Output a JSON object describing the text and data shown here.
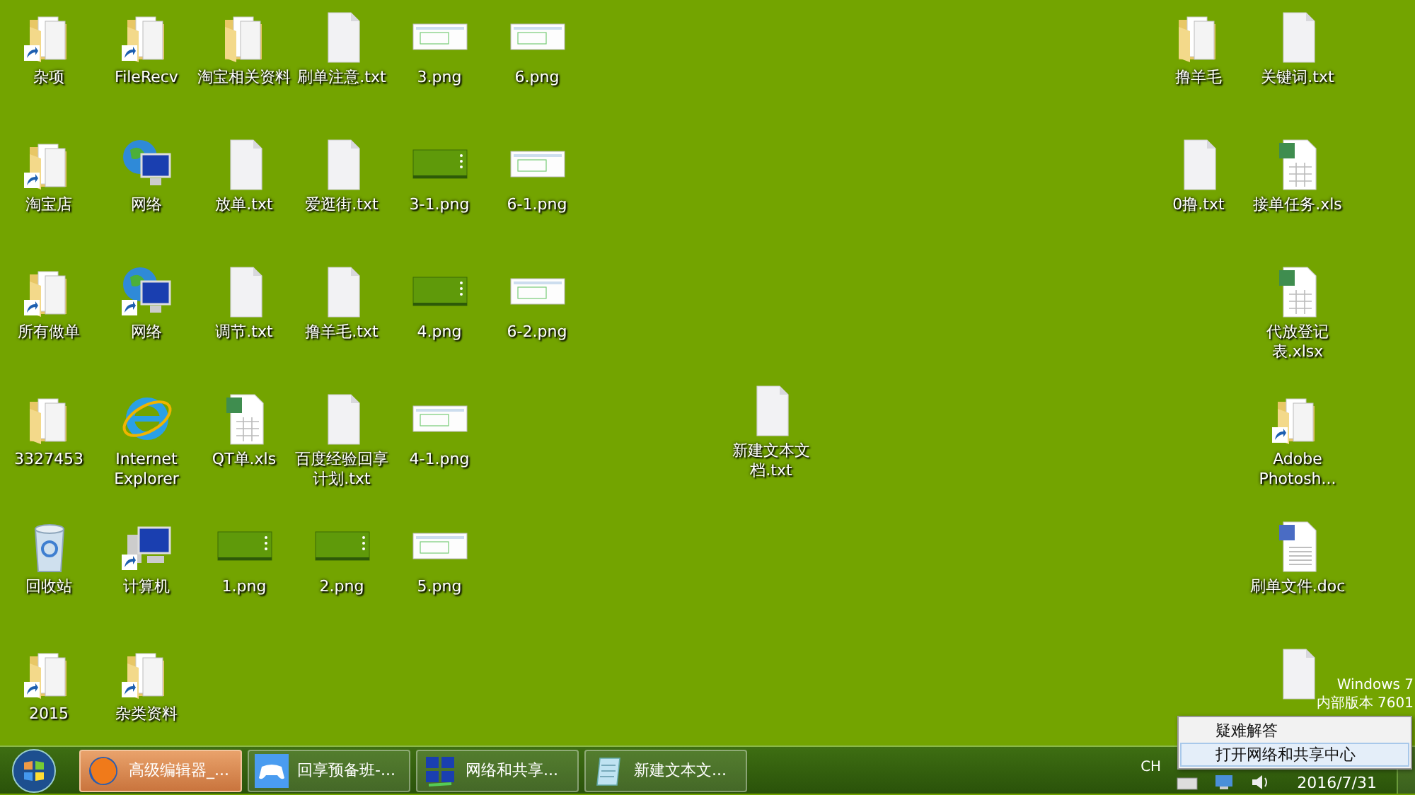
{
  "desktop": {
    "left_columns": [
      [
        {
          "label": "杂项",
          "kind": "folder",
          "shortcut": true
        },
        {
          "label": "淘宝店",
          "kind": "folder",
          "shortcut": true
        },
        {
          "label": "所有做单",
          "kind": "folder",
          "shortcut": true
        },
        {
          "label": "3327453",
          "kind": "folder",
          "shortcut": false
        },
        {
          "label": "回收站",
          "kind": "recycle",
          "shortcut": false
        },
        {
          "label": "2015",
          "kind": "folder",
          "shortcut": true
        }
      ],
      [
        {
          "label": "FileRecv",
          "kind": "folder",
          "shortcut": true
        },
        {
          "label": "网络",
          "kind": "network",
          "shortcut": false
        },
        {
          "label": "网络",
          "kind": "network",
          "shortcut": true
        },
        {
          "label": "Internet Explorer",
          "kind": "ie",
          "shortcut": false
        },
        {
          "label": "计算机",
          "kind": "computer",
          "shortcut": true
        },
        {
          "label": "杂类资料",
          "kind": "folder",
          "shortcut": true
        }
      ],
      [
        {
          "label": "淘宝相关资料",
          "kind": "folder",
          "shortcut": false
        },
        {
          "label": "放单.txt",
          "kind": "txt",
          "shortcut": false
        },
        {
          "label": "调节.txt",
          "kind": "txt",
          "shortcut": false
        },
        {
          "label": "QT单.xls",
          "kind": "xls",
          "shortcut": false
        },
        {
          "label": "1.png",
          "kind": "desktop-shot",
          "shortcut": false
        }
      ],
      [
        {
          "label": "刷单注意.txt",
          "kind": "txt",
          "shortcut": false
        },
        {
          "label": "爱逛街.txt",
          "kind": "txt",
          "shortcut": false
        },
        {
          "label": "撸羊毛.txt",
          "kind": "txt",
          "shortcut": false
        },
        {
          "label": "百度经验回享计划.txt",
          "kind": "txt",
          "shortcut": false
        },
        {
          "label": "2.png",
          "kind": "desktop-shot",
          "shortcut": false
        }
      ],
      [
        {
          "label": "3.png",
          "kind": "screenshot",
          "shortcut": false
        },
        {
          "label": "3-1.png",
          "kind": "desktop-shot",
          "shortcut": false
        },
        {
          "label": "4.png",
          "kind": "desktop-shot",
          "shortcut": false
        },
        {
          "label": "4-1.png",
          "kind": "screenshot",
          "shortcut": false
        },
        {
          "label": "5.png",
          "kind": "screenshot",
          "shortcut": false
        }
      ],
      [
        {
          "label": "6.png",
          "kind": "screenshot",
          "shortcut": false
        },
        {
          "label": "6-1.png",
          "kind": "screenshot",
          "shortcut": false
        },
        {
          "label": "6-2.png",
          "kind": "screenshot",
          "shortcut": false
        }
      ]
    ],
    "middle_column": [
      {
        "label": "新建文本文档.txt",
        "kind": "txt",
        "shortcut": false
      }
    ],
    "right_columns": [
      [
        {
          "label": "撸羊毛",
          "kind": "folder",
          "shortcut": false
        },
        {
          "label": "0撸.txt",
          "kind": "txt",
          "shortcut": false
        }
      ],
      [
        {
          "label": "关键词.txt",
          "kind": "txt",
          "shortcut": false
        },
        {
          "label": "接单任务.xls",
          "kind": "xls",
          "shortcut": false
        },
        {
          "label": "代放登记表.xlsx",
          "kind": "xls",
          "shortcut": false
        },
        {
          "label": "Adobe Photosh...",
          "kind": "folder",
          "shortcut": true
        },
        {
          "label": "刷单文件.doc",
          "kind": "doc",
          "shortcut": false
        },
        {
          "kind": "txt",
          "shortcut": false
        }
      ]
    ]
  },
  "os_watermark": [
    "Windows 7",
    "内部版本 7601"
  ],
  "context_menu": [
    {
      "label": "疑难解答",
      "selected": false
    },
    {
      "label": "打开网络和共享中心",
      "selected": true
    }
  ],
  "taskbar": {
    "buttons": [
      {
        "label": "高级编辑器_...",
        "kind": "firefox",
        "selected": true
      },
      {
        "label": "回享预备班-...",
        "kind": "gamepad",
        "selected": false
      },
      {
        "label": "网络和共享...",
        "kind": "network",
        "selected": false
      },
      {
        "label": "新建文本文...",
        "kind": "notepad",
        "selected": false
      }
    ],
    "tray": {
      "language": "CH",
      "date": "2016/7/31"
    }
  }
}
